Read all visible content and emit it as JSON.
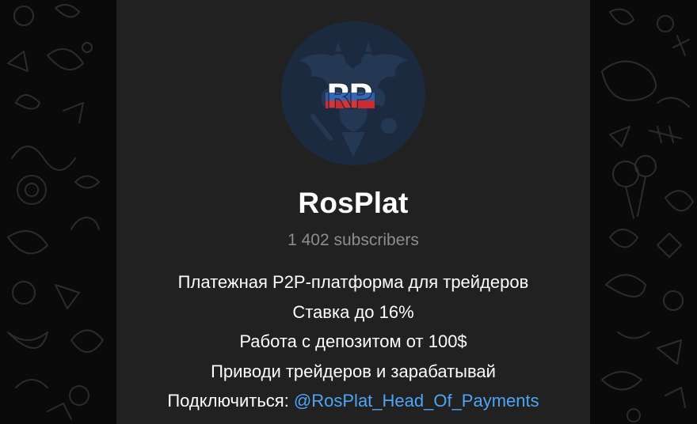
{
  "channel": {
    "title": "RosPlat",
    "subscribers": "1 402 subscribers",
    "avatar": {
      "icon": "double-headed-eagle-logo",
      "monogram": "RP",
      "colors": {
        "background": "#1b2a3e",
        "emblem": "#243753",
        "white": "#ffffff",
        "blue": "#2b5fb0",
        "red": "#d52b2b"
      }
    },
    "description": {
      "lines": [
        "Платежная P2P-платформа для трейдеров",
        "Ставка до 16%",
        "Работа с депозитом от 100$",
        "Приводи трейдеров и зарабатывай"
      ],
      "contact_prefix": "Подключиться: ",
      "contact_link": "@RosPlat_Head_Of_Payments"
    }
  },
  "theme": {
    "card_bg": "#212121",
    "page_bg": "#0a0a0a",
    "link_color": "#4ea4f6",
    "muted_text": "#8d8d8d"
  }
}
